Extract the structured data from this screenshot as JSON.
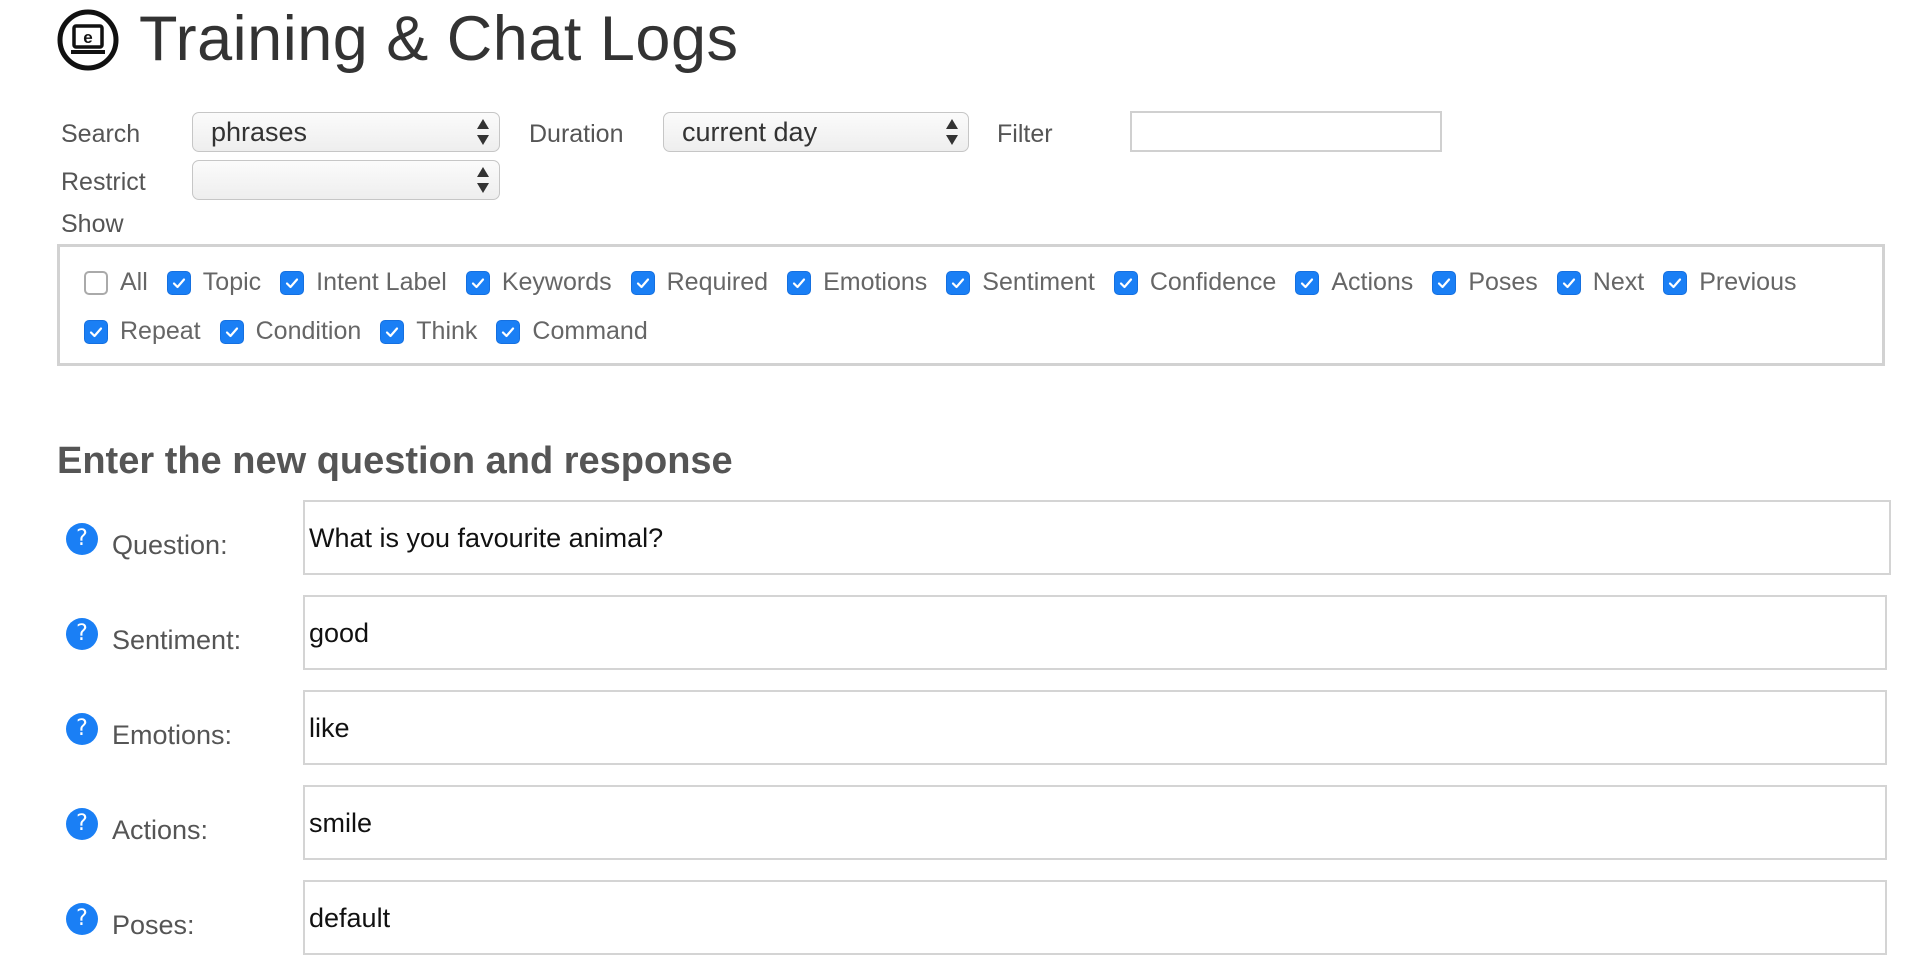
{
  "header": {
    "title": "Training & Chat Logs",
    "logo_icon": "e-monitor-logo-icon"
  },
  "filters": {
    "search_label": "Search",
    "search_value": "phrases",
    "duration_label": "Duration",
    "duration_value": "current day",
    "filter_label": "Filter",
    "filter_value": "",
    "restrict_label": "Restrict",
    "restrict_value": "",
    "show_label": "Show"
  },
  "show_options": [
    {
      "label": "All",
      "checked": false
    },
    {
      "label": "Topic",
      "checked": true
    },
    {
      "label": "Intent Label",
      "checked": true
    },
    {
      "label": "Keywords",
      "checked": true
    },
    {
      "label": "Required",
      "checked": true
    },
    {
      "label": "Emotions",
      "checked": true
    },
    {
      "label": "Sentiment",
      "checked": true
    },
    {
      "label": "Confidence",
      "checked": true
    },
    {
      "label": "Actions",
      "checked": true
    },
    {
      "label": "Poses",
      "checked": true
    },
    {
      "label": "Next",
      "checked": true
    },
    {
      "label": "Previous",
      "checked": true
    },
    {
      "label": "Repeat",
      "checked": true
    },
    {
      "label": "Condition",
      "checked": true
    },
    {
      "label": "Think",
      "checked": true
    },
    {
      "label": "Command",
      "checked": true
    }
  ],
  "form": {
    "title": "Enter the new question and response",
    "fields": [
      {
        "label": "Question:",
        "value": "What is you favourite animal?"
      },
      {
        "label": "Sentiment:",
        "value": "good"
      },
      {
        "label": "Emotions:",
        "value": "like"
      },
      {
        "label": "Actions:",
        "value": "smile"
      },
      {
        "label": "Poses:",
        "value": "default"
      }
    ],
    "help_glyph": "?"
  },
  "colors": {
    "accent": "#1a7ff5",
    "text": "#333333",
    "border": "#d2d2d2"
  }
}
